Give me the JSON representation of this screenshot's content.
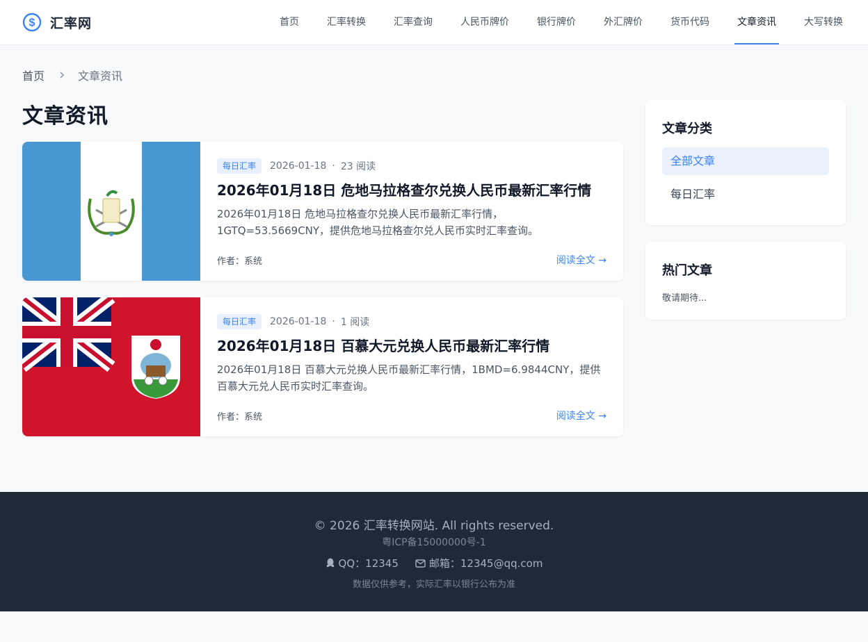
{
  "site": {
    "name": "汇率网",
    "brand_color": "#3b82f6"
  },
  "nav": {
    "items": [
      {
        "label": "首页",
        "active": false
      },
      {
        "label": "汇率转换",
        "active": false
      },
      {
        "label": "汇率查询",
        "active": false
      },
      {
        "label": "人民币牌价",
        "active": false
      },
      {
        "label": "银行牌价",
        "active": false
      },
      {
        "label": "外汇牌价",
        "active": false
      },
      {
        "label": "货币代码",
        "active": false
      },
      {
        "label": "文章资讯",
        "active": true
      },
      {
        "label": "大写转换",
        "active": false
      }
    ]
  },
  "breadcrumb": {
    "home": "首页",
    "current": "文章资讯",
    "separator_icon": "chevron-right-icon"
  },
  "page": {
    "title": "文章资讯"
  },
  "articles": [
    {
      "image": "guatemala-flag",
      "tag": "每日汇率",
      "date": "2026-01-18",
      "dot": "·",
      "reads": "23 阅读",
      "title": "2026年01月18日 危地马拉格查尔兑换人民币最新汇率行情",
      "desc": "2026年01月18日 危地马拉格查尔兑换人民币最新汇率行情，1GTQ=53.5669CNY，提供危地马拉格查尔兑人民币实时汇率查询。",
      "author": "作者：系统",
      "read_more": "阅读全文 →"
    },
    {
      "image": "bermuda-flag",
      "tag": "每日汇率",
      "date": "2026-01-18",
      "dot": "·",
      "reads": "1 阅读",
      "title": "2026年01月18日 百慕大元兑换人民币最新汇率行情",
      "desc": "2026年01月18日 百慕大元兑换人民币最新汇率行情，1BMD=6.9844CNY，提供百慕大元兑人民币实时汇率查询。",
      "author": "作者：系统",
      "read_more": "阅读全文 →"
    }
  ],
  "sidebar": {
    "categories": {
      "title": "文章分类",
      "items": [
        {
          "label": "全部文章",
          "active": true
        },
        {
          "label": "每日汇率",
          "active": false
        }
      ]
    },
    "hot": {
      "title": "热门文章",
      "empty": "敬请期待..."
    }
  },
  "footer": {
    "copyright": "© 2026 汇率转换网站. All rights reserved.",
    "icp": "粤ICP备15000000号-1",
    "qq": "QQ：12345",
    "email": "邮箱：12345@qq.com",
    "note": "数据仅供参考，实际汇率以银行公布为准"
  }
}
